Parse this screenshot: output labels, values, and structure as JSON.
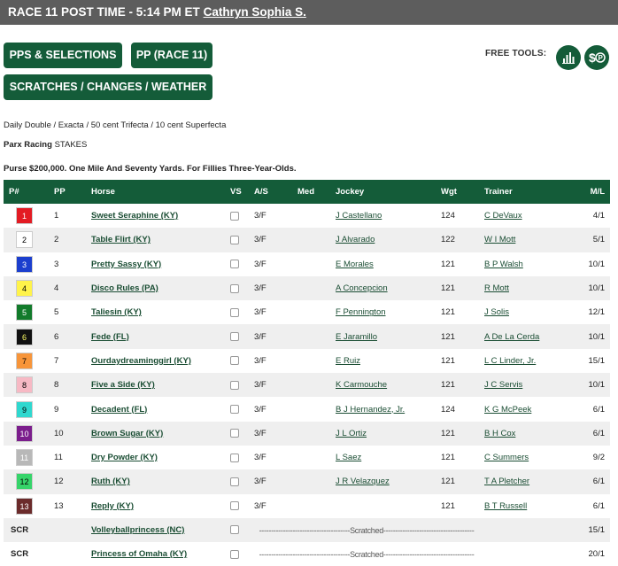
{
  "header": {
    "race_text": "RACE 11 POST TIME - 5:14 PM ET",
    "analyst": "Cathryn Sophia S."
  },
  "buttons": {
    "pps_selections": "PPS & SELECTIONS",
    "pp_race": "PP (RACE 11)",
    "scratches": "SCRATCHES / CHANGES / WEATHER"
  },
  "free_tools": {
    "label": "FREE TOOLS:"
  },
  "race_info": {
    "wagers": "Daily Double / Exacta / 50 cent Trifecta / 10 cent Superfecta",
    "track": "Parx Racing",
    "race_type": "STAKES",
    "purse": "Purse $200,000. One Mile And Seventy Yards. For Fillies Three-Year-Olds."
  },
  "columns": [
    "P#",
    "PP",
    "Horse",
    "VS",
    "A/S",
    "Med",
    "Jockey",
    "Wgt",
    "Trainer",
    "M/L"
  ],
  "entries": [
    {
      "pnum": "1",
      "pp": "1",
      "horse": "Sweet Seraphine (KY)",
      "as": "3/F",
      "jockey": "J Castellano",
      "wgt": "124",
      "trainer": "C DeVaux",
      "ml": "4/1",
      "bg": "#e31b23",
      "fg": "#ffffff"
    },
    {
      "pnum": "2",
      "pp": "2",
      "horse": "Table Flirt (KY)",
      "as": "3/F",
      "jockey": "J Alvarado",
      "wgt": "122",
      "trainer": "W I Mott",
      "ml": "5/1",
      "bg": "#ffffff",
      "fg": "#000000"
    },
    {
      "pnum": "3",
      "pp": "3",
      "horse": "Pretty Sassy (KY)",
      "as": "3/F",
      "jockey": "E Morales",
      "wgt": "121",
      "trainer": "B P Walsh",
      "ml": "10/1",
      "bg": "#1c3fce",
      "fg": "#ffffff"
    },
    {
      "pnum": "4",
      "pp": "4",
      "horse": "Disco Rules (PA)",
      "as": "3/F",
      "jockey": "A Concepcion",
      "wgt": "121",
      "trainer": "R Mott",
      "ml": "10/1",
      "bg": "#fff34a",
      "fg": "#000000"
    },
    {
      "pnum": "5",
      "pp": "5",
      "horse": "Taliesin (KY)",
      "as": "3/F",
      "jockey": "F Pennington",
      "wgt": "121",
      "trainer": "J Solis",
      "ml": "12/1",
      "bg": "#127b2b",
      "fg": "#ffffff"
    },
    {
      "pnum": "6",
      "pp": "6",
      "horse": "Fede (FL)",
      "as": "3/F",
      "jockey": "E Jaramillo",
      "wgt": "121",
      "trainer": "A De La Cerda",
      "ml": "10/1",
      "bg": "#111111",
      "fg": "#ffff66"
    },
    {
      "pnum": "7",
      "pp": "7",
      "horse": "Ourdaydreaminggirl (KY)",
      "as": "3/F",
      "jockey": "E Ruiz",
      "wgt": "121",
      "trainer": "L C Linder, Jr.",
      "ml": "15/1",
      "bg": "#f7953a",
      "fg": "#000000"
    },
    {
      "pnum": "8",
      "pp": "8",
      "horse": "Five a Side (KY)",
      "as": "3/F",
      "jockey": "K Carmouche",
      "wgt": "121",
      "trainer": "J C Servis",
      "ml": "10/1",
      "bg": "#f7b9c4",
      "fg": "#000000"
    },
    {
      "pnum": "9",
      "pp": "9",
      "horse": "Decadent (FL)",
      "as": "3/F",
      "jockey": "B J Hernandez, Jr.",
      "wgt": "124",
      "trainer": "K G McPeek",
      "ml": "6/1",
      "bg": "#2fd8cf",
      "fg": "#000000"
    },
    {
      "pnum": "10",
      "pp": "10",
      "horse": "Brown Sugar (KY)",
      "as": "3/F",
      "jockey": "J L Ortiz",
      "wgt": "121",
      "trainer": "B H Cox",
      "ml": "6/1",
      "bg": "#7b1d8c",
      "fg": "#ffffff"
    },
    {
      "pnum": "11",
      "pp": "11",
      "horse": "Dry Powder (KY)",
      "as": "3/F",
      "jockey": "L Saez",
      "wgt": "121",
      "trainer": "C Summers",
      "ml": "9/2",
      "bg": "#b8b8b8",
      "fg": "#ffffff"
    },
    {
      "pnum": "12",
      "pp": "12",
      "horse": "Ruth (KY)",
      "as": "3/F",
      "jockey": "J R Velazquez",
      "wgt": "121",
      "trainer": "T A Pletcher",
      "ml": "6/1",
      "bg": "#36d46a",
      "fg": "#000000"
    },
    {
      "pnum": "13",
      "pp": "13",
      "horse": "Reply (KY)",
      "as": "3/F",
      "jockey": "",
      "wgt": "121",
      "trainer": "B T Russell",
      "ml": "6/1",
      "bg": "#6b2b2b",
      "fg": "#ffffff"
    }
  ],
  "scratched": [
    {
      "pnum": "SCR",
      "horse": "Volleyballprincess (NC)",
      "text": "--------------------------------------Scratched--------------------------------------",
      "ml": "15/1"
    },
    {
      "pnum": "SCR",
      "horse": "Princess of Omaha (KY)",
      "text": "--------------------------------------Scratched--------------------------------------",
      "ml": "20/1"
    }
  ]
}
